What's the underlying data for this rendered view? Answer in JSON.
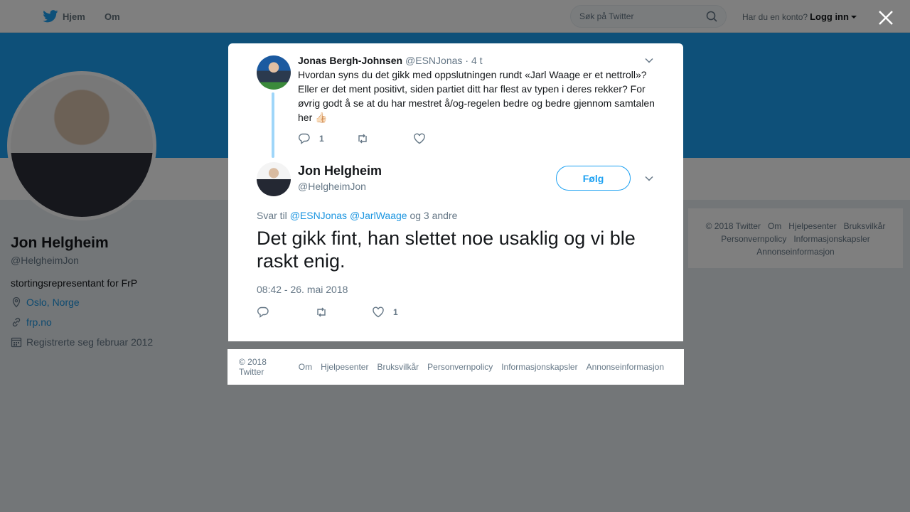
{
  "nav": {
    "home_label": "Hjem",
    "about_label": "Om",
    "search_placeholder": "Søk på Twitter",
    "account_prompt": "Har du en konto?",
    "login_label": "Logg inn"
  },
  "profile": {
    "name": "Jon Helgheim",
    "handle": "@HelgheimJon",
    "bio": "stortingsrepresentant for FrP",
    "location": "Oslo, Norge",
    "website": "frp.no",
    "joined": "Registrerte seg februar 2012"
  },
  "side_footer": {
    "items": [
      "© 2018 Twitter",
      "Om",
      "Hjelpesenter",
      "Bruksvilkår",
      "Personvernpolicy",
      "Informasjonskapsler",
      "Annonseinformasjon"
    ]
  },
  "parent_tweet": {
    "author_name": "Jonas Bergh-Johnsen",
    "author_handle": "@ESNJonas",
    "time": "· 4 t",
    "text": "Hvordan syns du det gikk med oppslutningen rundt «Jarl Waage er et nettroll»? Eller er det ment positivt, siden partiet ditt har flest av typen i deres rekker? For øvrig godt å se at du har mestret å/og-regelen bedre og bedre gjennom samtalen her 👍🏻",
    "reply_count": "1"
  },
  "main_tweet": {
    "author_name": "Jon Helgheim",
    "author_handle": "@HelgheimJon",
    "follow_label": "Følg",
    "reply_prefix": "Svar til",
    "mention1": "@ESNJonas",
    "mention2": "@JarlWaage",
    "reply_suffix": "og 3 andre",
    "text": "Det gikk fint, han slettet noe usaklig og vi ble raskt enig.",
    "timestamp": "08:42 - 26. mai 2018",
    "like_count": "1"
  },
  "modal_footer": {
    "items": [
      "© 2018 Twitter",
      "Om",
      "Hjelpesenter",
      "Bruksvilkår",
      "Personvernpolicy",
      "Informasjonskapsler",
      "Annonseinformasjon"
    ]
  },
  "colors": {
    "brand": "#1da1f2",
    "link": "#1b95e0",
    "muted": "#657786"
  }
}
